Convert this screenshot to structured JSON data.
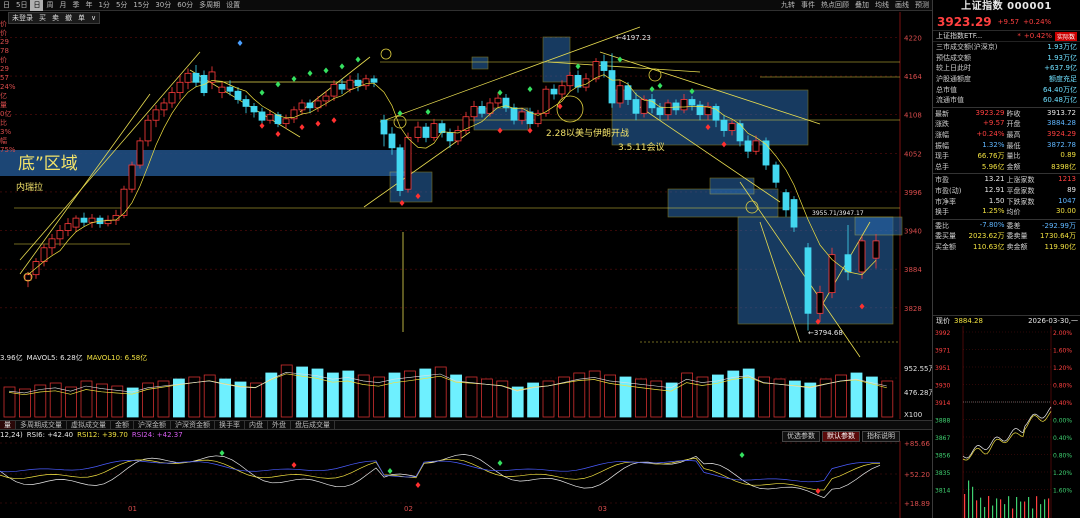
{
  "toolbar": {
    "items": [
      "日",
      "5日",
      "日",
      "周",
      "月",
      "季",
      "年",
      "1分",
      "5分",
      "15分",
      "30分",
      "60分",
      "多周期",
      "设置"
    ],
    "active_index": 2,
    "right_items": [
      "九转",
      "事件",
      "热点回顾",
      "叠加",
      "均线",
      "画线",
      "预测"
    ]
  },
  "subbar": {
    "items": [
      "未登录",
      "买",
      "卖",
      "撤",
      "单",
      "∨"
    ]
  },
  "left_col": {
    "items": [
      "价",
      "价",
      "29",
      "78",
      "价",
      "29",
      "57",
      "24%",
      "亿",
      "量",
      "0亿",
      "比",
      "3%",
      "幅",
      "75%"
    ]
  },
  "main": {
    "y_ticks": [
      "4220",
      "4164",
      "4108",
      "4052",
      "3996",
      "3940",
      "3884",
      "3828"
    ],
    "labels": {
      "high": "4197.23",
      "low": "3794.68",
      "mid": "3955.71/3947.17",
      "zone": "底”区域",
      "inner": "内瑞拉",
      "note1": "2.28以美与伊朗开战",
      "note2": "3.5.11会议"
    }
  },
  "volume": {
    "header": [
      "3.96亿",
      "MAVOL5: 6.28亿",
      "MAVOL10: 6.58亿"
    ],
    "y_ticks": [
      "952.55万",
      "476.28万",
      "X100"
    ]
  },
  "ind_tabs": {
    "items": [
      "量",
      "多周期成交量",
      "虚拟成交量",
      "金额",
      "沪深金额",
      "沪深资金额",
      "换手率",
      "内盘",
      "外盘",
      "盘后成交量"
    ],
    "active_index": 0
  },
  "rsi": {
    "header": [
      "12,24)",
      "RSI6: +42.40",
      "RSI12: +39.70",
      "RSI24: +42.37"
    ],
    "y_ticks": [
      "+85.66",
      "+52.20",
      "+18.89"
    ],
    "params": [
      "优选参数",
      "默认参数",
      "指标说明"
    ],
    "param_active": 1,
    "months": [
      "01",
      "02",
      "03"
    ]
  },
  "panel": {
    "title": "上证指数 000001",
    "price": "3923.29",
    "change": "+9.57",
    "pct": "+0.24%",
    "etf_name": "上证指数ETF...",
    "etf_star": "*",
    "etf_pct": "+0.42%",
    "etf_badge": "实际数",
    "group1": [
      {
        "l": "三市成交额(沪深京)",
        "v": "1.93万亿"
      },
      {
        "l": "预估成交额",
        "v": "1.93万亿"
      },
      {
        "l": "较上日此时",
        "v": "+637.9亿"
      },
      {
        "l": "沪股通额度",
        "v": "额度充足"
      },
      {
        "l": "总市值",
        "v": "64.40万亿"
      },
      {
        "l": "流通市值",
        "v": "60.48万亿"
      }
    ],
    "group2": [
      {
        "l1": "最新",
        "v1": "3923.29",
        "c1": "red",
        "l2": "昨收",
        "v2": "3913.72",
        "c2": "wht"
      },
      {
        "l1": "涨跌",
        "v1": "+9.57",
        "c1": "red",
        "l2": "开盘",
        "v2": "3884.28",
        "c2": "blue"
      },
      {
        "l1": "涨幅",
        "v1": "+0.24%",
        "c1": "red",
        "l2": "最高",
        "v2": "3924.29",
        "c2": "red"
      },
      {
        "l1": "振幅",
        "v1": "1.32%",
        "c1": "blue",
        "l2": "最低",
        "v2": "3872.78",
        "c2": "blue"
      },
      {
        "l1": "现手",
        "v1": "66.76万",
        "c1": "yel",
        "l2": "量比",
        "v2": "0.89",
        "c2": "yel"
      },
      {
        "l1": "总手",
        "v1": "5.96亿",
        "c1": "yel",
        "l2": "金额",
        "v2": "8398亿",
        "c2": "yel"
      }
    ],
    "group3": [
      {
        "l1": "市盈",
        "v1": "13.21",
        "c1": "wht",
        "l2": "上涨家数",
        "v2": "1213",
        "c2": "red"
      },
      {
        "l1": "市盈(动)",
        "v1": "12.91",
        "c1": "wht",
        "l2": "平盘家数",
        "v2": "89",
        "c2": "wht"
      },
      {
        "l1": "市净率",
        "v1": "1.50",
        "c1": "wht",
        "l2": "下跌家数",
        "v2": "1047",
        "c2": "blue"
      },
      {
        "l1": "换手",
        "v1": "1.25%",
        "c1": "yel",
        "l2": "均价",
        "v2": "30.00",
        "c2": "yel"
      }
    ],
    "group4": [
      {
        "l1": "委比",
        "v1": "-7.80%",
        "c1": "blue",
        "l2": "委差",
        "v2": "-292.99万",
        "c2": "blue"
      },
      {
        "l1": "委买量",
        "v1": "2023.62万",
        "c1": "yel",
        "l2": "委卖量",
        "v2": "1730.64万",
        "c2": "yel"
      },
      {
        "l1": "买金额",
        "v1": "110.63亿",
        "c1": "yel",
        "l2": "卖金额",
        "v2": "119.90亿",
        "c2": "yel"
      }
    ],
    "mini": {
      "label": "现价",
      "value": "3884.28",
      "date": "2026-03-30,一",
      "y_ticks": [
        "3992",
        "3971",
        "3951",
        "3930",
        "3914",
        "3888",
        "3867",
        "3856",
        "3835",
        "3814"
      ],
      "pct_ticks": [
        "2.00%",
        "1.60%",
        "1.20%",
        "0.80%",
        "0.40%",
        "0.00%",
        "0.40%",
        "0.80%",
        "1.20%",
        "1.60%"
      ]
    }
  },
  "colors": {
    "up": "#ff3b3b",
    "down": "#43d8f0",
    "ma": "#f0e040",
    "grid": "#6a1010",
    "box": "#2a6bb0"
  }
}
